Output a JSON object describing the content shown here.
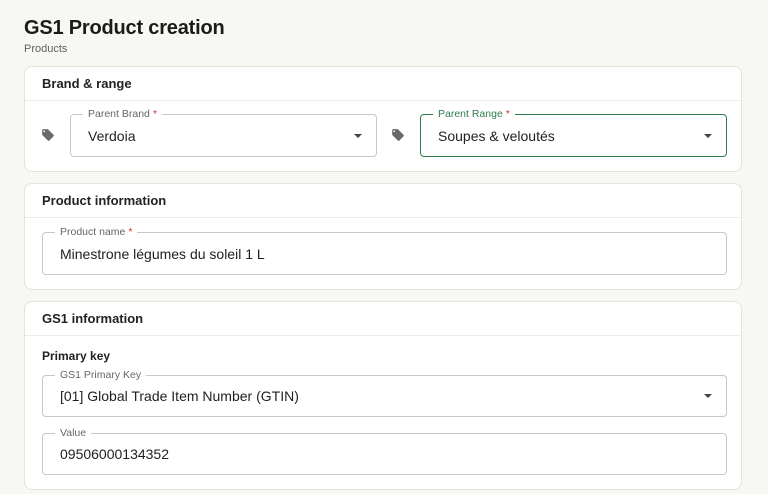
{
  "page": {
    "title": "GS1 Product creation",
    "breadcrumb": "Products"
  },
  "brand_range": {
    "title": "Brand & range",
    "parent_brand": {
      "label": "Parent Brand",
      "required_mark": "*",
      "value": "Verdoia"
    },
    "parent_range": {
      "label": "Parent Range",
      "required_mark": "*",
      "value": "Soupes & veloutés"
    }
  },
  "product_info": {
    "title": "Product information",
    "product_name": {
      "label": "Product name",
      "required_mark": "*",
      "value": "Minestrone légumes du soleil 1 L"
    }
  },
  "gs1_info": {
    "title": "GS1 information",
    "primary_key_heading": "Primary key",
    "primary_key": {
      "label": "GS1 Primary Key",
      "value": "[01] Global Trade Item Number (GTIN)"
    },
    "value_field": {
      "label": "Value",
      "value": "09506000134352"
    }
  },
  "colors": {
    "accent": "#2e7d4f",
    "required": "#d32f2f",
    "background": "#f7f7f3",
    "border": "#c9c9bf"
  },
  "icons": {
    "brand_icon": "tag-icon",
    "range_icon": "tag-icon",
    "dropdown": "caret-down-icon"
  }
}
